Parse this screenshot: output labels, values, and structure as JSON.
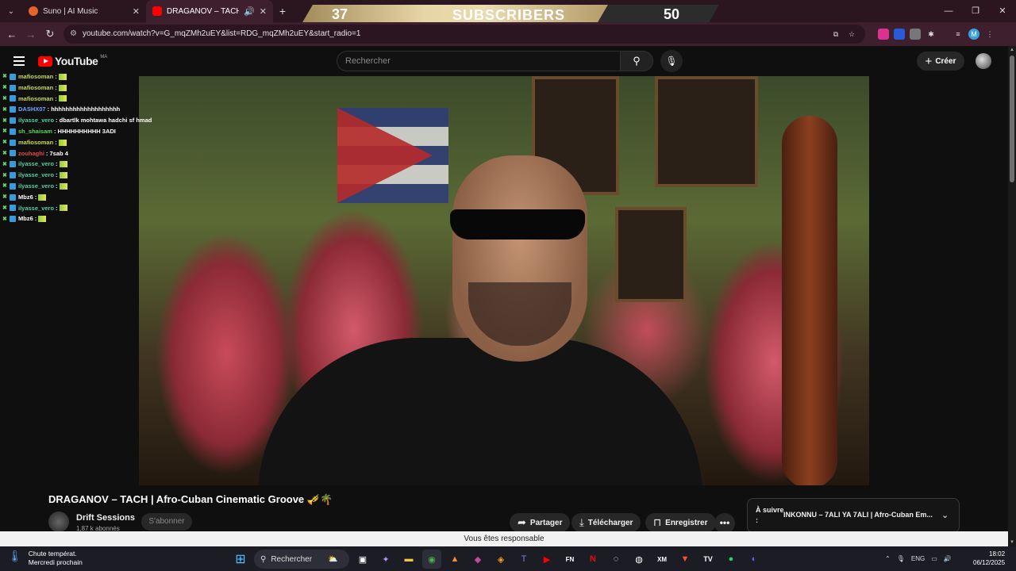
{
  "browser": {
    "tabs": [
      {
        "title": "Suno | AI Music",
        "favicon_color": "#e8632c"
      },
      {
        "title": "DRAGANOV – TACH | Afro-C",
        "favicon_color": "#ff0000"
      }
    ],
    "url": "youtube.com/watch?v=G_mqZMh2uEY&list=RDG_mqZMh2uEY&start_radio=1",
    "profile_initial": "M"
  },
  "overlay": {
    "subs_current": "37",
    "subs_label": "SUBSCRIBERS",
    "subs_goal": "50"
  },
  "youtube": {
    "logo_text": "YouTube",
    "country_code": "MA",
    "search_placeholder": "Rechercher",
    "create_label": "Créer"
  },
  "chat": [
    {
      "user": "mafiosoman",
      "msg": "",
      "color": "#c6d94f",
      "gif": true
    },
    {
      "user": "mafiosoman",
      "msg": "",
      "color": "#c6d94f",
      "gif": true
    },
    {
      "user": "mafiosoman",
      "msg": "",
      "color": "#c6d94f",
      "gif": true
    },
    {
      "user": "DASHX07",
      "msg": "hhhhhhhhhhhhhhhhhhh",
      "color": "#6aa5ff",
      "gif": false
    },
    {
      "user": "ilyasse_vero",
      "msg": "dbartlk mohtawa hadchi sf hmad",
      "color": "#4fd0a0",
      "gif": false
    },
    {
      "user": "sh_shaisam",
      "msg": "HHHHHHHHHH 3ADI",
      "color": "#5bd35b",
      "gif": false
    },
    {
      "user": "mafiosoman",
      "msg": "",
      "color": "#c6d94f",
      "gif": true
    },
    {
      "user": "zouhaghi",
      "msg": "7sab 4",
      "color": "#e04848",
      "gif": false
    },
    {
      "user": "ilyasse_vero",
      "msg": "",
      "color": "#4fd0a0",
      "gif": true
    },
    {
      "user": "ilyasse_vero",
      "msg": "",
      "color": "#4fd0a0",
      "gif": true
    },
    {
      "user": "ilyasse_vero",
      "msg": "",
      "color": "#4fd0a0",
      "gif": true
    },
    {
      "user": "Mbz6",
      "msg": "",
      "color": "#ffffff",
      "gif": true
    },
    {
      "user": "ilyasse_vero",
      "msg": "",
      "color": "#4fd0a0",
      "gif": true
    },
    {
      "user": "Mbz6",
      "msg": "",
      "color": "#ffffff",
      "gif": true
    }
  ],
  "video": {
    "title": "DRAGANOV – TACH | Afro-Cuban Cinematic Groove 🎺🌴",
    "channel": "Drift Sessions",
    "subscribers": "1,87 k abonnés",
    "subscribe_label": "S'abonner",
    "share_label": "Partager",
    "download_label": "Télécharger",
    "save_label": "Enregistrer",
    "more_label": "•••",
    "up_next_label": "À suivre :",
    "up_next_title": "INKONNU – 7ALI YA 7ALI | Afro-Cuban Em..."
  },
  "notice": "Vous êtes responsable",
  "taskbar": {
    "weather_line1": "Chute températ.",
    "weather_line2": "Mercredi prochain",
    "search_label": "Rechercher",
    "lang": "ENG",
    "time": "18:02",
    "date": "06/12/2025"
  }
}
